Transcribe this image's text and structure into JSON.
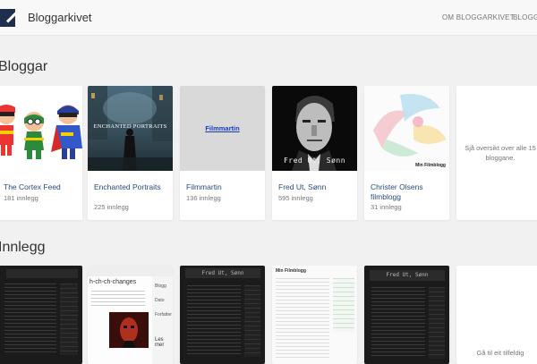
{
  "header": {
    "brand": "Bloggarkivet",
    "nav": [
      "OM BLOGGARKIVET",
      "BLOGG"
    ]
  },
  "sections": {
    "blogs_title": "Bloggar",
    "posts_title": "Innlegg"
  },
  "blogs": [
    {
      "title": "The Cortex Feed",
      "count": "181 innlegg"
    },
    {
      "title": "Enchanted Portraits",
      "count": "225 innlegg"
    },
    {
      "title": "Filmmartin",
      "count": "136 innlegg"
    },
    {
      "title": "Fred Ut, Sønn",
      "count": "595 innlegg"
    },
    {
      "title": "Christer Olsens filmblogg",
      "count": "31 innlegg"
    }
  ],
  "thumb_text": {
    "enchanted": "ENCHANTED PORTRAITS",
    "filmmartin": "Filmmartin",
    "fred": "Fred Ut, Sønn",
    "minfilmblogg": "Min Filmblogg",
    "changes": "h-ch-ch-changes",
    "side_labels": [
      "Blogg",
      "Dato",
      "Forfatter",
      "Les mer"
    ],
    "fred_banner": "Fred Ut, Sønn",
    "min_header": "Min Filmblogg"
  },
  "more_blogs": "Sjå oversikt over alle 15 bloggane.",
  "more_posts": "Gå til eit tilfeldig"
}
